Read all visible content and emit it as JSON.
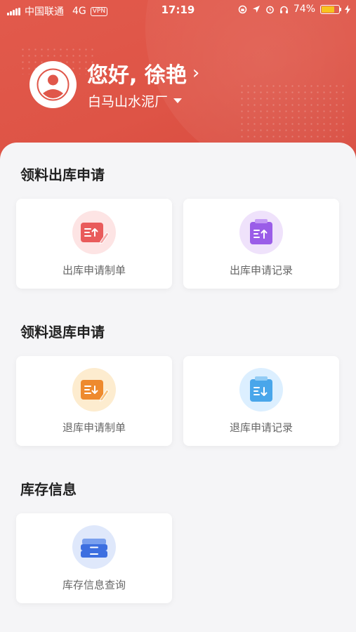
{
  "status_bar": {
    "carrier": "中国联通",
    "network": "4G",
    "vpn": "VPN",
    "time": "17:19",
    "battery": "74%",
    "battery_level": 0.74,
    "battery_color": "#f7c31f"
  },
  "header": {
    "greeting": "您好, 徐艳",
    "factory": "白马山水泥厂",
    "background_color": "#de5446"
  },
  "sections": [
    {
      "title": "领料出库申请",
      "cards": [
        {
          "label": "出库申请制单",
          "icon": "edit-doc-upload-icon",
          "color": "#e95b5b"
        },
        {
          "label": "出库申请记录",
          "icon": "clipboard-upload-icon",
          "color": "#9a5de8"
        }
      ]
    },
    {
      "title": "领料退库申请",
      "cards": [
        {
          "label": "退库申请制单",
          "icon": "edit-doc-download-icon",
          "color": "#ee8a2e"
        },
        {
          "label": "退库申请记录",
          "icon": "clipboard-download-icon",
          "color": "#49a6ea"
        }
      ]
    },
    {
      "title": "库存信息",
      "cards": [
        {
          "label": "库存信息查询",
          "icon": "inventory-drawer-icon",
          "color": "#3d6fe0"
        }
      ]
    }
  ]
}
